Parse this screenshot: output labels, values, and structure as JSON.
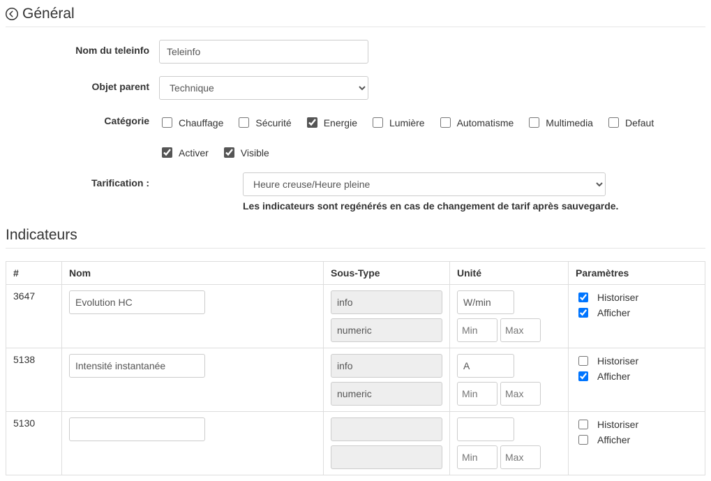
{
  "header": {
    "title": "Général"
  },
  "form": {
    "name_label": "Nom du teleinfo",
    "name_value": "Teleinfo",
    "parent_label": "Objet parent",
    "parent_value": "Technique",
    "category_label": "Catégorie",
    "categories": [
      {
        "label": "Chauffage",
        "checked": false
      },
      {
        "label": "Sécurité",
        "checked": false
      },
      {
        "label": "Energie",
        "checked": true
      },
      {
        "label": "Lumière",
        "checked": false
      },
      {
        "label": "Automatisme",
        "checked": false
      },
      {
        "label": "Multimedia",
        "checked": false
      },
      {
        "label": "Defaut",
        "checked": false
      }
    ],
    "flags": [
      {
        "label": "Activer",
        "checked": true
      },
      {
        "label": "Visible",
        "checked": true
      }
    ],
    "tarif_label": "Tarification :",
    "tarif_value": "Heure creuse/Heure pleine",
    "tarif_help": "Les indicateurs sont regénérés en cas de changement de tarif après sauvegarde."
  },
  "indicators": {
    "title": "Indicateurs",
    "columns": {
      "id": "#",
      "nom": "Nom",
      "soustype": "Sous-Type",
      "unite": "Unité",
      "param": "Paramètres"
    },
    "min_placeholder": "Min",
    "max_placeholder": "Max",
    "param_hist": "Historiser",
    "param_aff": "Afficher",
    "rows": [
      {
        "id": "3647",
        "nom": "Evolution HC",
        "st1": "info",
        "st2": "numeric",
        "unit": "W/min",
        "hist": true,
        "aff": true
      },
      {
        "id": "5138",
        "nom": "Intensité instantanée",
        "st1": "info",
        "st2": "numeric",
        "unit": "A",
        "hist": false,
        "aff": true
      },
      {
        "id": "5130",
        "nom": "",
        "st1": "",
        "st2": "",
        "unit": "",
        "hist": false,
        "aff": false
      }
    ]
  }
}
